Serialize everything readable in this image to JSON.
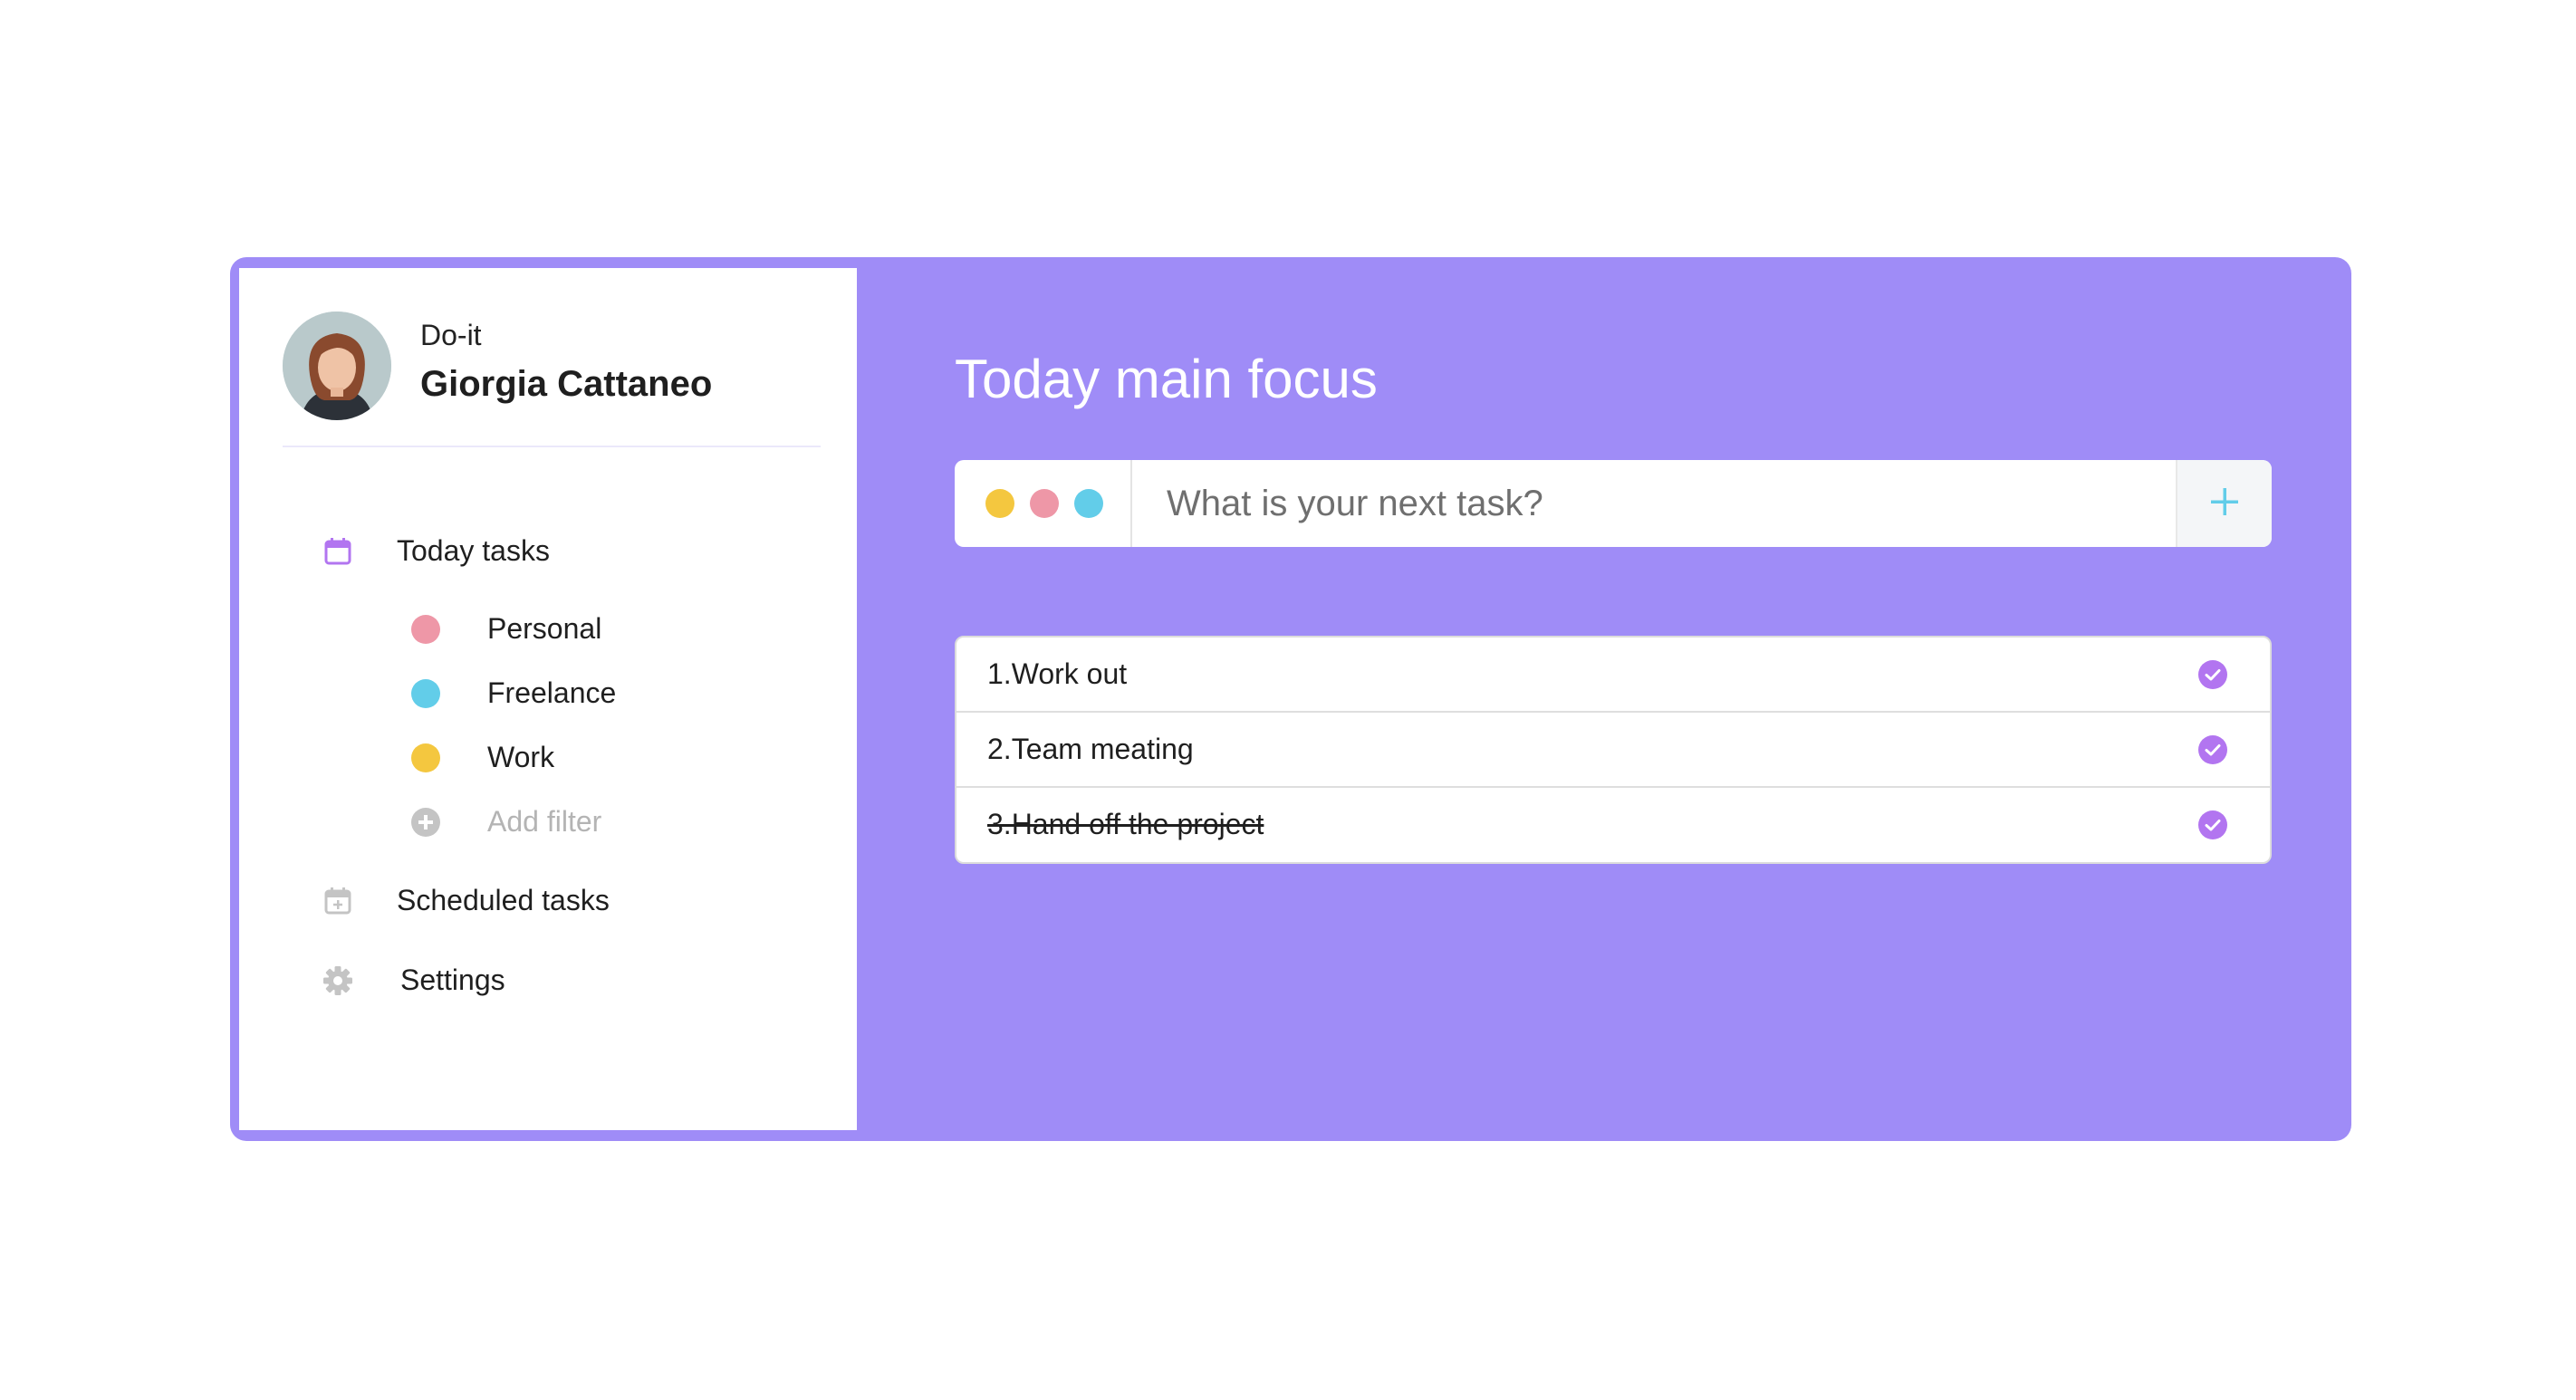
{
  "app": {
    "name": "Do-it",
    "user_name": "Giorgia Cattaneo"
  },
  "colors": {
    "accent": "#9f8cf7",
    "purple": "#b275f0",
    "pink": "#ee97a7",
    "cyan": "#62cde9",
    "yellow": "#f4c73f",
    "muted": "#b4b4b4"
  },
  "sidebar": {
    "today": {
      "label": "Today tasks",
      "icon": "calendar-icon"
    },
    "filters": [
      {
        "label": "Personal",
        "color": "#ee97a7"
      },
      {
        "label": "Freelance",
        "color": "#62cde9"
      },
      {
        "label": "Work",
        "color": "#f4c73f"
      }
    ],
    "add_filter": {
      "label": "Add filter",
      "icon": "plus-circle-icon"
    },
    "scheduled": {
      "label": "Scheduled tasks",
      "icon": "calendar-plus-icon"
    },
    "settings": {
      "label": "Settings",
      "icon": "gear-icon"
    }
  },
  "main": {
    "title": "Today main focus",
    "input_placeholder": "What is your next task?",
    "color_dots": [
      "#f4c73f",
      "#ee97a7",
      "#62cde9"
    ],
    "tasks": [
      {
        "text": "1.Work out",
        "done": false
      },
      {
        "text": "2.Team meating",
        "done": false
      },
      {
        "text": "3.Hand off the project",
        "done": true
      }
    ]
  }
}
